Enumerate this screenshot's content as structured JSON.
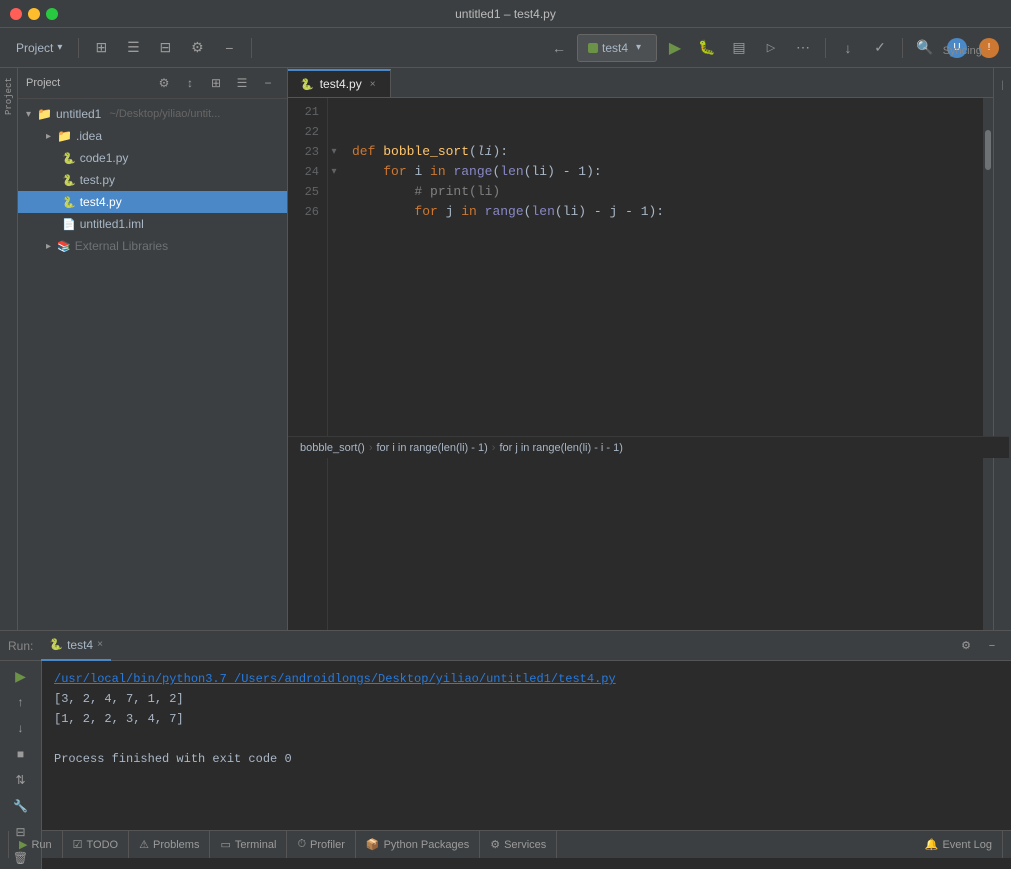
{
  "window": {
    "title": "untitled1 – test4.py"
  },
  "toolbar": {
    "project_label": "Project",
    "run_config": "test4",
    "search_placeholder": "Search"
  },
  "project_panel": {
    "title": "Project",
    "root": {
      "name": "untitled1",
      "path": "~/Desktop/yiliao/untit...",
      "expanded": true
    },
    "files": [
      {
        "name": ".idea",
        "type": "folder",
        "indent": 1,
        "expanded": true
      },
      {
        "name": "code1.py",
        "type": "python",
        "indent": 2
      },
      {
        "name": "test.py",
        "type": "python",
        "indent": 2
      },
      {
        "name": "test4.py",
        "type": "python",
        "indent": 2,
        "selected": true
      },
      {
        "name": "untitled1.iml",
        "type": "iml",
        "indent": 2
      },
      {
        "name": "External Libraries",
        "type": "folder",
        "indent": 1,
        "expanded": false
      }
    ]
  },
  "editor": {
    "tab": {
      "name": "test4.py",
      "active": true
    },
    "lines": [
      {
        "num": 21,
        "content": ""
      },
      {
        "num": 22,
        "content": ""
      },
      {
        "num": 23,
        "content": "def bobble_sort(li):",
        "type": "def"
      },
      {
        "num": 24,
        "content": "    for i in range(len(li) - 1):",
        "type": "for"
      },
      {
        "num": 25,
        "content": "        # print(li)",
        "type": "comment"
      },
      {
        "num": 26,
        "content": "        for j in range(len(li) - j - 1):",
        "type": "for"
      }
    ],
    "breadcrumb": {
      "func": "bobble_sort()",
      "loop1": "for i in range(len(li) - 1)",
      "loop2": "for j in range(len(li) - i - 1)"
    },
    "syncing": "Syncing..."
  },
  "run_panel": {
    "run_label": "Run:",
    "tab": "test4",
    "output_lines": [
      {
        "text": "/usr/local/bin/python3.7 /Users/androidlongs/Desktop/yiliao/untitled1/test4.py",
        "type": "link"
      },
      {
        "text": "[3, 2, 4, 7, 1, 2]",
        "type": "normal"
      },
      {
        "text": "[1, 2, 2, 3, 4, 7]",
        "type": "normal"
      },
      {
        "text": "",
        "type": "normal"
      },
      {
        "text": "Process finished with exit code 0",
        "type": "normal"
      }
    ]
  },
  "status_bar": {
    "run_label": "Run",
    "todo_label": "TODO",
    "problems_label": "Problems",
    "terminal_label": "Terminal",
    "profiler_label": "Profiler",
    "python_packages_label": "Python Packages",
    "services_label": "Services",
    "event_log_label": "Event Log"
  },
  "icons": {
    "play": "▶",
    "stop": "■",
    "rerun": "↺",
    "up": "↑",
    "down": "↓",
    "settings": "⚙",
    "close": "×",
    "chevron_right": "›",
    "chevron_down": "▾",
    "fold": "▸",
    "gear": "⚙",
    "search": "🔍",
    "python_file": "🐍",
    "folder": "📁",
    "wrench": "🔧",
    "terminal": "🖥",
    "heart": "♥"
  }
}
